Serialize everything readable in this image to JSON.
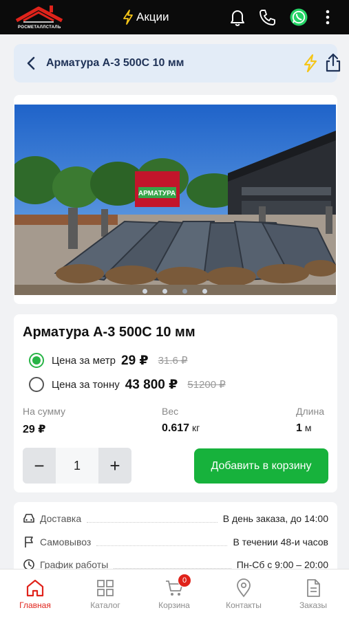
{
  "app": {
    "brand_name": "РОСМЕТАЛЛСТАЛЬ",
    "promo_label": "Акции"
  },
  "header": {
    "title": "Арматура А-3 500С 10 мм"
  },
  "gallery": {
    "slides": 4,
    "active_slide": 3,
    "photo_sign_text": "АРМАТУРА"
  },
  "product": {
    "title": "Арматура А-3 500С 10 мм",
    "prices": [
      {
        "label": "Цена за метр",
        "value": "29 ₽",
        "old": "31.6 ₽",
        "selected": true
      },
      {
        "label": "Цена за тонну",
        "value": "43 800 ₽",
        "old": "51200 ₽",
        "selected": false
      }
    ],
    "stats": [
      {
        "label": "На сумму",
        "value": "29 ₽",
        "unit": ""
      },
      {
        "label": "Вес",
        "value": "0.617",
        "unit": "кг"
      },
      {
        "label": "Длина",
        "value": "1",
        "unit": "м"
      }
    ],
    "quantity": "1",
    "minus_symbol": "−",
    "plus_symbol": "+",
    "add_to_cart_label": "Добавить в корзину"
  },
  "delivery": [
    {
      "icon": "car-icon",
      "label": "Доставка",
      "value": "В день заказа, до 14:00"
    },
    {
      "icon": "flag-icon",
      "label": "Самовывоз",
      "value": "В течении 48-и часов"
    },
    {
      "icon": "clock-icon",
      "label": "График работы",
      "value": "Пн-Сб с 9:00 – 20:00"
    }
  ],
  "nav": {
    "items": [
      {
        "icon": "home-icon",
        "label": "Главная",
        "active": true
      },
      {
        "icon": "catalog-icon",
        "label": "Каталог",
        "active": false
      },
      {
        "icon": "cart-icon",
        "label": "Корзина",
        "active": false,
        "badge": "0"
      },
      {
        "icon": "location-icon",
        "label": "Контакты",
        "active": false
      },
      {
        "icon": "orders-icon",
        "label": "Заказы",
        "active": false
      }
    ]
  },
  "colors": {
    "accent_green": "#17b23c",
    "accent_red": "#e0231b",
    "header_blue": "#1f3257",
    "flash_yellow": "#f5c518"
  }
}
